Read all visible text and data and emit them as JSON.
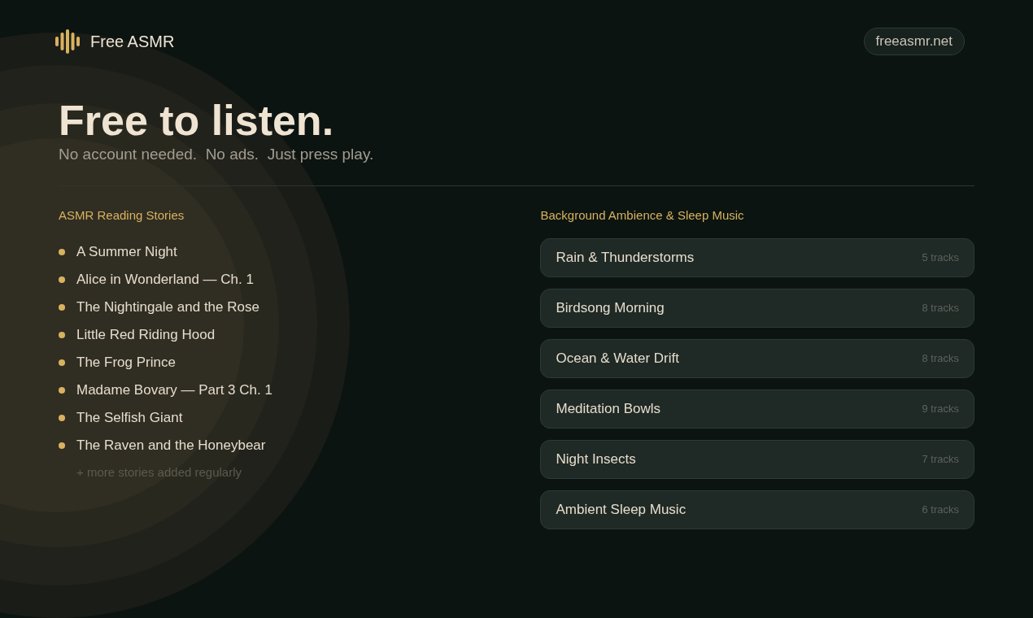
{
  "brand": {
    "name": "Free ASMR"
  },
  "site_link": "freeasmr.net",
  "hero": {
    "title": "Free to listen.",
    "subtitle": "No account needed.  No ads.  Just press play."
  },
  "stories": {
    "heading": "ASMR Reading Stories",
    "items": [
      "A Summer Night",
      "Alice in Wonderland — Ch. 1",
      "The Nightingale and the Rose",
      "Little Red Riding Hood",
      "The Frog Prince",
      "Madame Bovary — Part 3 Ch. 1",
      "The Selfish Giant",
      "The Raven and the Honeybear"
    ],
    "footnote": "+ more stories added regularly"
  },
  "ambience": {
    "heading": "Background Ambience & Sleep Music",
    "items": [
      {
        "title": "Rain & Thunderstorms",
        "count": "5 tracks"
      },
      {
        "title": "Birdsong Morning",
        "count": "8 tracks"
      },
      {
        "title": "Ocean & Water Drift",
        "count": "8 tracks"
      },
      {
        "title": "Meditation Bowls",
        "count": "9 tracks"
      },
      {
        "title": "Night Insects",
        "count": "7 tracks"
      },
      {
        "title": "Ambient Sleep Music",
        "count": "6 tracks"
      }
    ]
  }
}
